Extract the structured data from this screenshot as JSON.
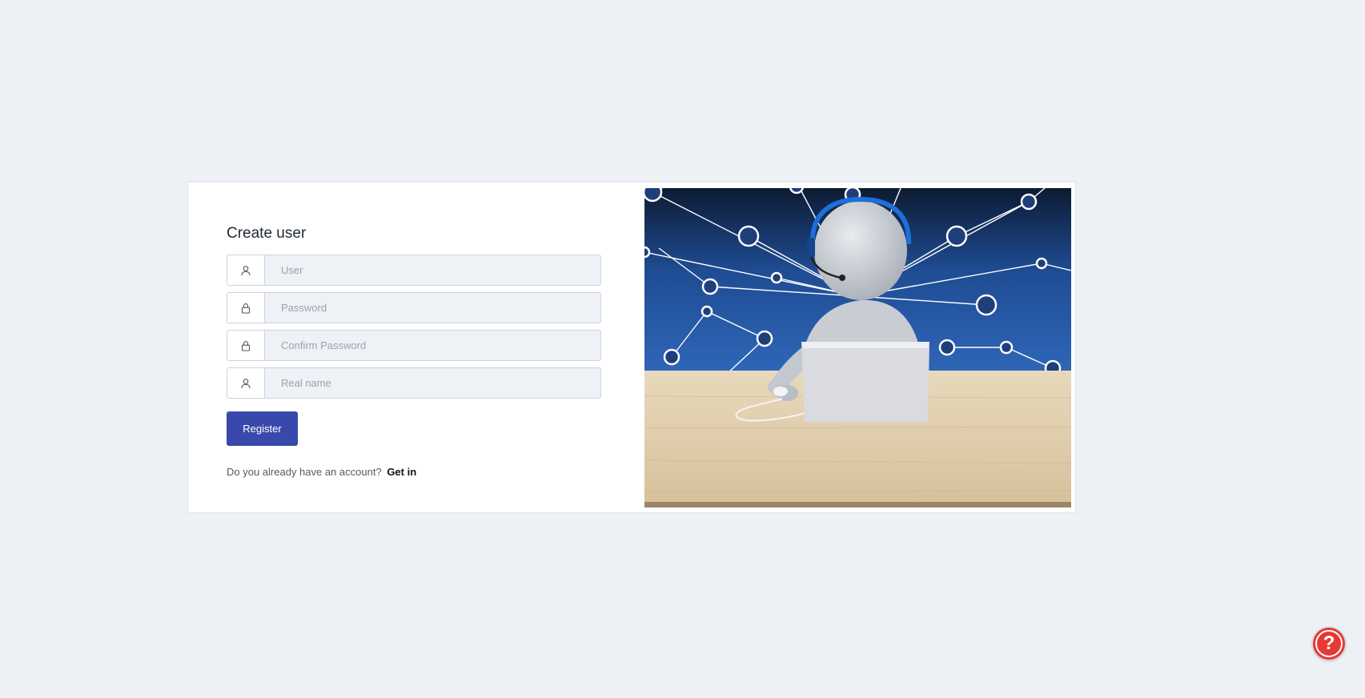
{
  "register_form": {
    "title": "Create user",
    "fields": [
      {
        "icon": "user-icon",
        "placeholder": "User",
        "value": ""
      },
      {
        "icon": "lock-icon",
        "placeholder": "Password",
        "value": ""
      },
      {
        "icon": "lock-icon",
        "placeholder": "Confirm Password",
        "value": ""
      },
      {
        "icon": "user-icon",
        "placeholder": "Real name",
        "value": ""
      }
    ],
    "register_label": "Register",
    "login_prompt": "Do you already have an account?",
    "login_link": "Get in"
  },
  "help": {
    "label": "?",
    "icon": "help-icon"
  },
  "colors": {
    "background": "#edf1f5",
    "primary": "#3949ab",
    "help": "#e53935"
  }
}
